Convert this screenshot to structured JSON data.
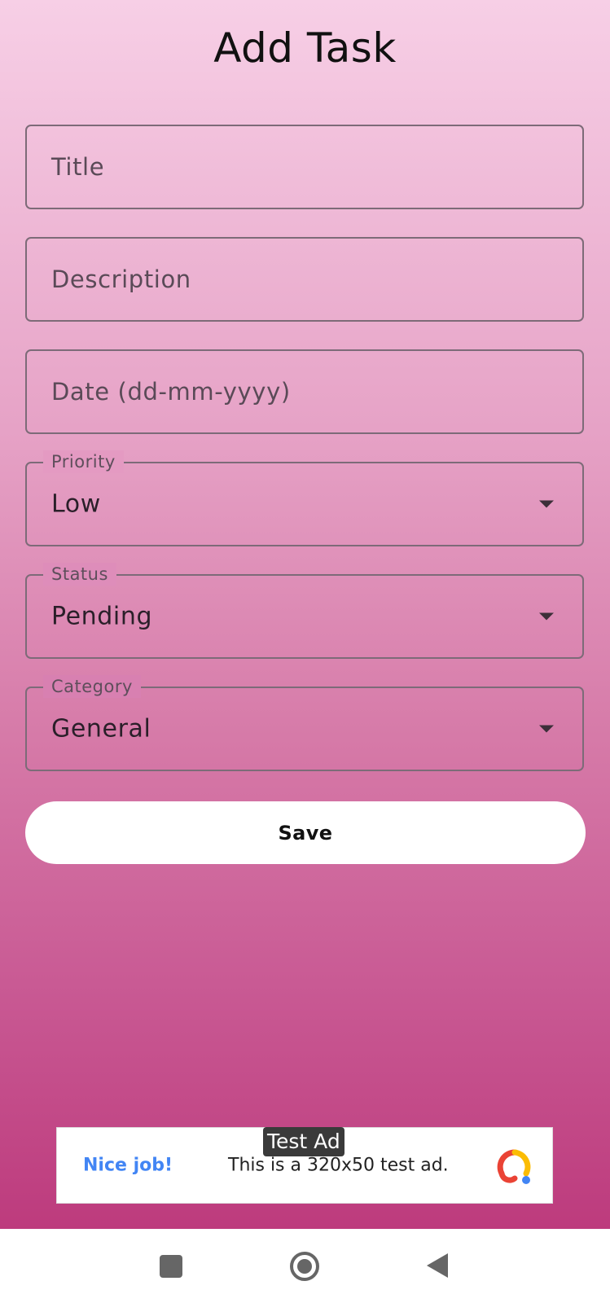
{
  "header": {
    "title": "Add Task"
  },
  "form": {
    "title_placeholder": "Title",
    "description_placeholder": "Description",
    "date_placeholder": "Date (dd-mm-yyyy)",
    "priority": {
      "label": "Priority",
      "value": "Low"
    },
    "status": {
      "label": "Status",
      "value": "Pending"
    },
    "category": {
      "label": "Category",
      "value": "General"
    },
    "save_label": "Save"
  },
  "ad": {
    "tag": "Test Ad",
    "headline": "Nice job!",
    "body": "This is a 320x50 test ad."
  },
  "navbar": {
    "recents": "recents-icon",
    "home": "home-icon",
    "back": "back-icon"
  },
  "colors": {
    "gradient_top": "#f7cfe6",
    "gradient_bottom": "#bd3b7d",
    "field_border": "#7d6b78",
    "ad_link": "#4285f4"
  }
}
